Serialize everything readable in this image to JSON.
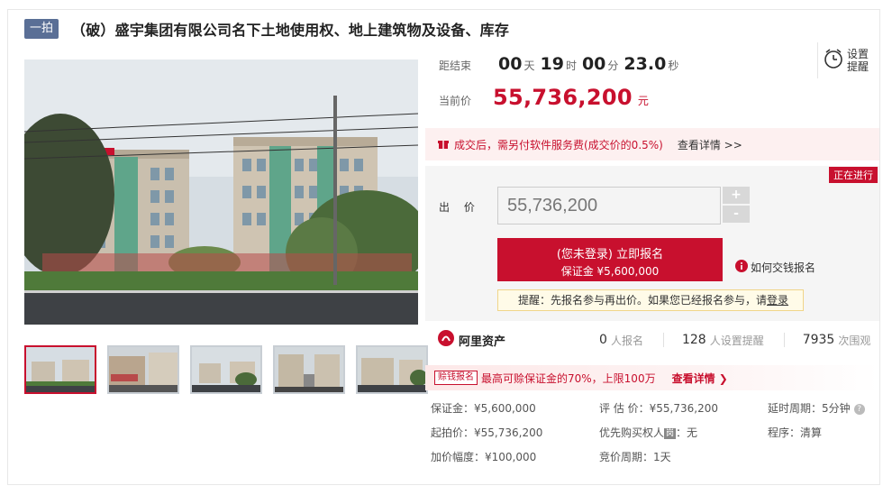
{
  "title": {
    "round_tag": "一拍",
    "text": "（破）盛宇集团有限公司名下土地使用权、地上建筑物及设备、库存"
  },
  "countdown": {
    "label": "距结束",
    "days": "00",
    "days_unit": "天",
    "hours": "19",
    "hours_unit": "时",
    "minutes": "00",
    "minutes_unit": "分",
    "seconds": "23.0",
    "seconds_unit": "秒"
  },
  "reminder": {
    "line1": "设置",
    "line2": "提醒",
    "icon": "alarm-clock-icon"
  },
  "current_price": {
    "label": "当前价",
    "value": "55,736,200",
    "unit": "元"
  },
  "fee_notice": {
    "text": "成交后，需另付软件服务费(成交价的0.5%)",
    "link": "查看详情 >>",
    "icon": "gift-icon"
  },
  "bid": {
    "status_tag": "正在进行",
    "label": "出 价",
    "input_value": "55,736,200",
    "plus": "+",
    "minus": "-",
    "register_line1": "(您未登录) 立即报名",
    "register_line2": "保证金 ¥5,600,000",
    "howto": "如何交钱报名",
    "tip_prefix": "提醒：先报名参与再出价。如果您已经报名参与，请",
    "tip_link": "登录"
  },
  "stats": {
    "brand": "阿里资产",
    "registered_count": "0",
    "registered_label": "人报名",
    "reminder_count": "128",
    "reminder_label": "人设置提醒",
    "views_count": "7935",
    "views_label": "次围观"
  },
  "promo": {
    "badge": "赊钱报名",
    "text": "最高可赊保证金的70%，上限100万",
    "link": "查看详情 ❯"
  },
  "details": {
    "deposit": "保证金：¥5,600,000",
    "appraisal": "评 估 价：¥55,736,200",
    "extension": "延时周期：5分钟",
    "start_price": "起拍价：¥55,736,200",
    "priority_label": "优先购买权人",
    "priority_badge": "岗",
    "priority_value": "：无",
    "procedure": "程序：清算",
    "increment": "加价幅度：¥100,000",
    "bidding_period": "竞价周期：1天"
  },
  "colors": {
    "accent": "#c8102e",
    "tag_blue": "#5a6f96"
  }
}
